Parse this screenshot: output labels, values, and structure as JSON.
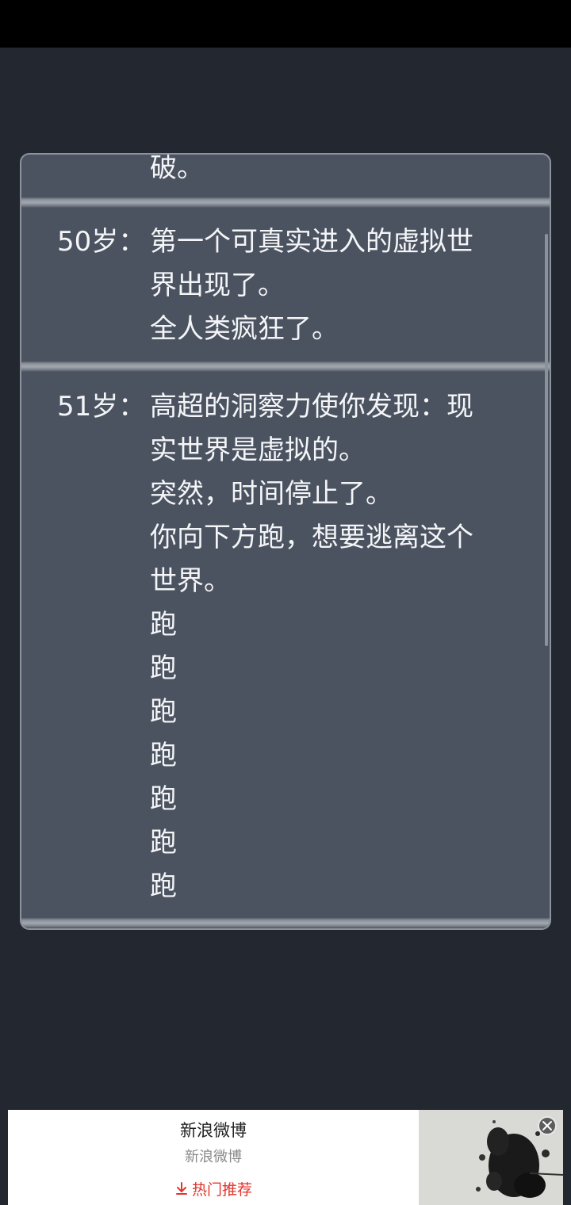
{
  "timeline": {
    "partial_entry": {
      "lines": [
        "破。"
      ]
    },
    "entries": [
      {
        "age": "50岁：",
        "lines": [
          "第一个可真实进入的虚拟世",
          "界出现了。",
          "全人类疯狂了。"
        ]
      },
      {
        "age": "51岁：",
        "lines": [
          "高超的洞察力使你发现：现",
          "实世界是虚拟的。",
          "突然，时间停止了。",
          "你向下方跑，想要逃离这个",
          "世界。",
          "跑",
          "跑",
          "跑",
          "跑",
          "跑",
          "跑",
          "跑"
        ]
      }
    ]
  },
  "ad": {
    "title": "新浪微博",
    "subtitle": "新浪微博",
    "cta_label": "热门推荐",
    "cta_icon": "download-arrow-icon",
    "close_icon": "close-icon"
  },
  "colors": {
    "background": "#23272f",
    "panel": "#4b5361",
    "text": "#f4f5f7",
    "accent_red": "#e3342c"
  }
}
